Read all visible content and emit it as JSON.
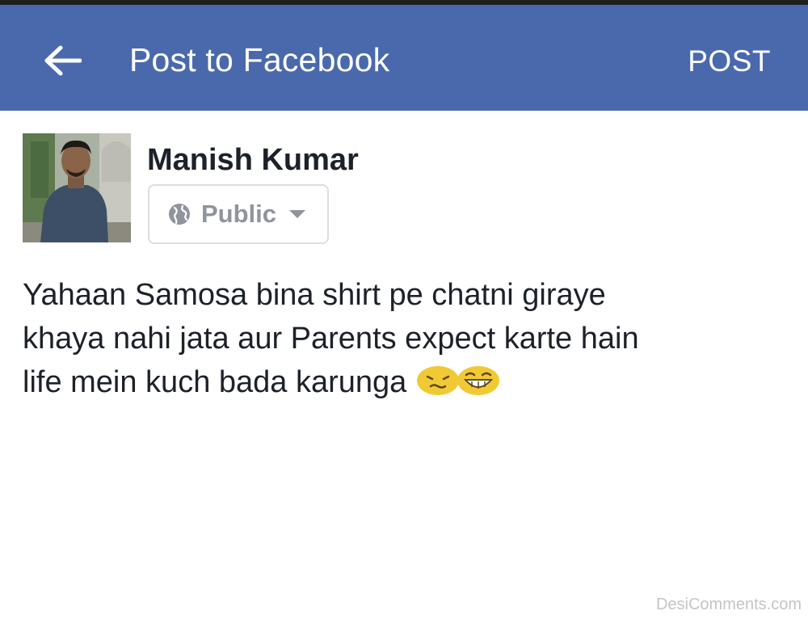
{
  "app": {
    "colors": {
      "header_bg": "#4a69ad",
      "header_text": "#ffffff",
      "name_text": "#1d2129",
      "privacy_text": "#90949c",
      "emoji_yellow": "#f0c934"
    }
  },
  "header": {
    "back_icon": "arrow-left-icon",
    "title": "Post to Facebook",
    "post_label": "POST"
  },
  "composer": {
    "user_name": "Manish Kumar",
    "privacy": {
      "icon": "globe-icon",
      "label": "Public",
      "caret_icon": "caret-down-icon"
    },
    "post_lines": [
      "Yahaan Samosa bina shirt pe chatni giraye",
      "khaya nahi jata aur Parents expect karte hain",
      "life mein kuch bada karunga"
    ],
    "emojis": [
      "confounded-face-emoji",
      "grinning-face-emoji"
    ]
  },
  "watermark": "DesiComments.com"
}
